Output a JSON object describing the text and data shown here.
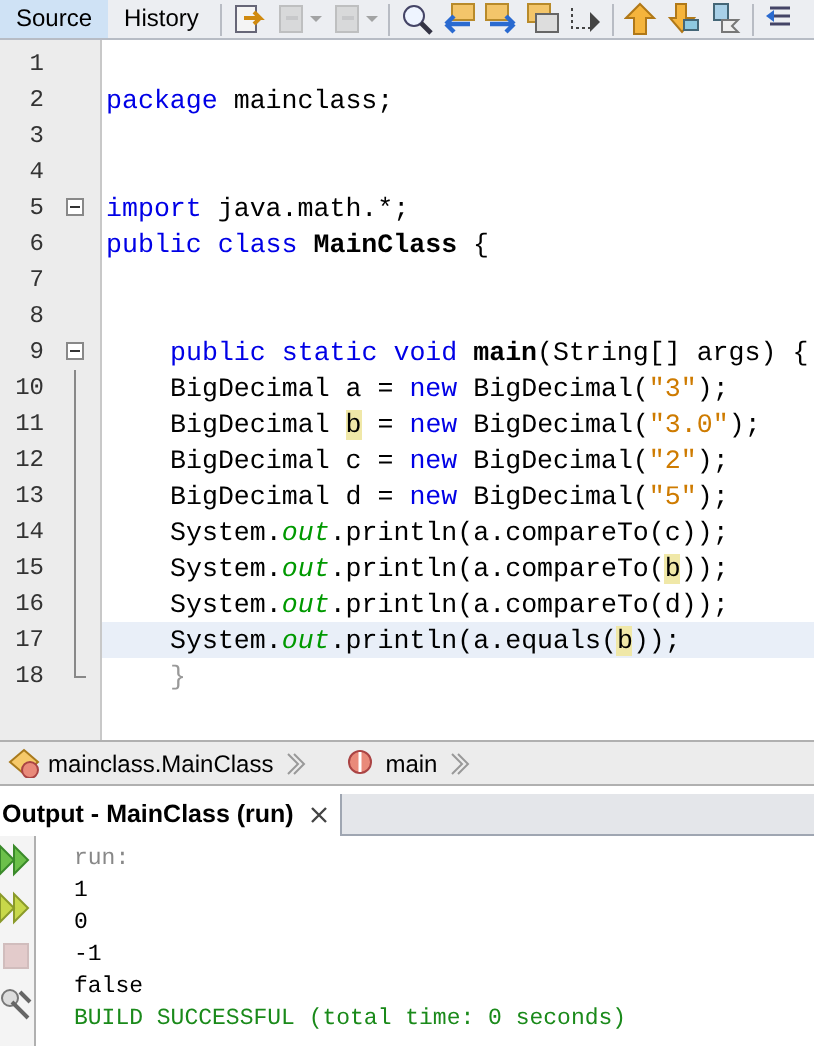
{
  "editor_tabs": [
    {
      "label": "Source",
      "selected": true
    },
    {
      "label": "History",
      "selected": false
    }
  ],
  "toolbar": [
    {
      "kind": "last-edit",
      "disabled": false
    },
    {
      "kind": "back",
      "disabled": true
    },
    {
      "kind": "forward",
      "disabled": true
    },
    {
      "kind": "find",
      "disabled": false
    },
    {
      "kind": "find-previous",
      "disabled": false
    },
    {
      "kind": "find-next",
      "disabled": false
    },
    {
      "kind": "highlight",
      "disabled": false
    },
    {
      "kind": "rect-select",
      "disabled": false
    },
    {
      "kind": "bookmark-previous",
      "disabled": false
    },
    {
      "kind": "bookmark-next",
      "disabled": false
    },
    {
      "kind": "bookmark-toggle",
      "disabled": false
    },
    {
      "kind": "shift-left",
      "disabled": false
    }
  ],
  "code_lines": [
    {
      "number": "1"
    },
    {
      "number": "2",
      "tokens": [
        {
          "text": "package",
          "kind": "keyword"
        },
        {
          "text": " mainclass;",
          "kind": "plain"
        }
      ]
    },
    {
      "number": "3"
    },
    {
      "number": "4"
    },
    {
      "number": "5",
      "expanded": true,
      "tokens": [
        {
          "text": "import",
          "kind": "keyword"
        },
        {
          "text": " java.math.*;",
          "kind": "plain"
        }
      ]
    },
    {
      "number": "6",
      "tokens": [
        {
          "text": "public class ",
          "kind": "keyword"
        },
        {
          "text": "MainClass",
          "kind": "declaration"
        },
        {
          "text": " {",
          "kind": "plain"
        }
      ]
    },
    {
      "number": "7"
    },
    {
      "number": "8"
    },
    {
      "number": "9",
      "expanded": true,
      "indented": true,
      "tokens": [
        {
          "text": "public static void ",
          "kind": "keyword"
        },
        {
          "text": "main",
          "kind": "declaration"
        },
        {
          "text": "(String[] args) {",
          "kind": "plain"
        }
      ],
      "children": [
        {
          "number": "10",
          "indented": true,
          "tokens": [
            {
              "text": "BigDecimal a = ",
              "kind": "plain"
            },
            {
              "text": "new",
              "kind": "keyword"
            },
            {
              "text": " BigDecimal(",
              "kind": "plain"
            },
            {
              "text": "\"3\"",
              "kind": "string"
            },
            {
              "text": ");",
              "kind": "plain"
            }
          ]
        },
        {
          "number": "11",
          "indented": true,
          "tokens": [
            {
              "text": "BigDecimal ",
              "kind": "plain"
            },
            {
              "text": "b",
              "kind": "occurrence"
            },
            {
              "text": " = ",
              "kind": "plain"
            },
            {
              "text": "new",
              "kind": "keyword"
            },
            {
              "text": " BigDecimal(",
              "kind": "plain"
            },
            {
              "text": "\"3.0\"",
              "kind": "string"
            },
            {
              "text": ");",
              "kind": "plain"
            }
          ]
        },
        {
          "number": "12",
          "indented": true,
          "tokens": [
            {
              "text": "BigDecimal c = ",
              "kind": "plain"
            },
            {
              "text": "new",
              "kind": "keyword"
            },
            {
              "text": " BigDecimal(",
              "kind": "plain"
            },
            {
              "text": "\"2\"",
              "kind": "string"
            },
            {
              "text": ");",
              "kind": "plain"
            }
          ]
        },
        {
          "number": "13",
          "indented": true,
          "tokens": [
            {
              "text": "BigDecimal d = ",
              "kind": "plain"
            },
            {
              "text": "new",
              "kind": "keyword"
            },
            {
              "text": " BigDecimal(",
              "kind": "plain"
            },
            {
              "text": "\"5\"",
              "kind": "string"
            },
            {
              "text": ");",
              "kind": "plain"
            }
          ]
        },
        {
          "number": "14",
          "indented": true,
          "tokens": [
            {
              "text": "System.",
              "kind": "plain"
            },
            {
              "text": "out",
              "kind": "field"
            },
            {
              "text": ".println(a.compareTo(c));",
              "kind": "plain"
            }
          ]
        },
        {
          "number": "15",
          "indented": true,
          "tokens": [
            {
              "text": "System.",
              "kind": "plain"
            },
            {
              "text": "out",
              "kind": "field"
            },
            {
              "text": ".println(a.compareTo(",
              "kind": "plain"
            },
            {
              "text": "b",
              "kind": "occurrence"
            },
            {
              "text": "));",
              "kind": "plain"
            }
          ]
        },
        {
          "number": "16",
          "indented": true,
          "tokens": [
            {
              "text": "System.",
              "kind": "plain"
            },
            {
              "text": "out",
              "kind": "field"
            },
            {
              "text": ".println(a.compareTo(d));",
              "kind": "plain"
            }
          ]
        },
        {
          "number": "17",
          "indented": true,
          "current": true,
          "tokens": [
            {
              "text": "System.",
              "kind": "plain"
            },
            {
              "text": "out",
              "kind": "field"
            },
            {
              "text": ".println(a.equals(",
              "kind": "plain"
            },
            {
              "text": "b",
              "kind": "occurrence"
            },
            {
              "text": "));",
              "kind": "plain"
            }
          ]
        },
        {
          "number": "18",
          "indented": true,
          "tokens": [
            {
              "text": "}",
              "kind": "dim"
            }
          ]
        }
      ]
    }
  ],
  "breadcrumbs": [
    {
      "kind": "class",
      "label": "mainclass.MainClass"
    },
    {
      "kind": "method",
      "label": "main"
    }
  ],
  "output": {
    "title": "Output - MainClass (run)",
    "actions": [
      {
        "kind": "rerun",
        "disabled": false
      },
      {
        "kind": "rerun-args",
        "disabled": false
      },
      {
        "kind": "stop",
        "disabled": true
      },
      {
        "kind": "settings",
        "disabled": false
      }
    ],
    "lines": [
      {
        "text": "run:",
        "kind": "info"
      },
      {
        "text": "1",
        "kind": "plain"
      },
      {
        "text": "0",
        "kind": "plain"
      },
      {
        "text": "-1",
        "kind": "plain"
      },
      {
        "text": "false",
        "kind": "plain"
      },
      {
        "text": "BUILD SUCCESSFUL (total time: 0 seconds)",
        "kind": "success"
      }
    ]
  }
}
